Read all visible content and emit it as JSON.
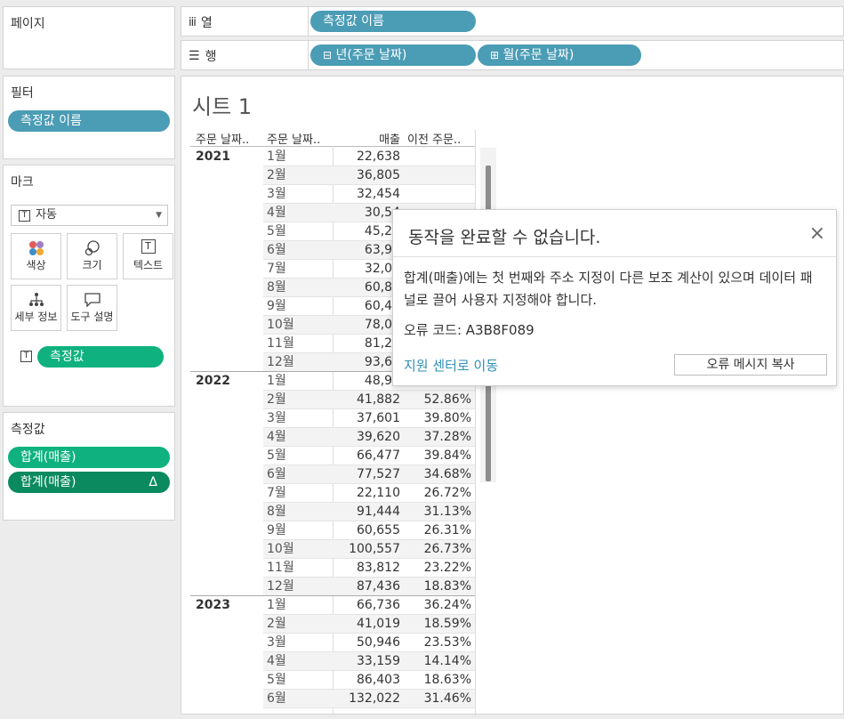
{
  "pages": {
    "title": "페이지"
  },
  "columns_shelf": {
    "label": "열",
    "pill": "측정값 이름"
  },
  "rows_shelf": {
    "label": "행",
    "pills": [
      "년(주문 날짜)",
      "월(주문 날짜)"
    ]
  },
  "filters": {
    "title": "필터",
    "pill": "측정값 이름"
  },
  "marks": {
    "title": "마크",
    "type": "자동",
    "buttons": [
      {
        "label": "색상",
        "icon": "color-icon"
      },
      {
        "label": "크기",
        "icon": "size-icon"
      },
      {
        "label": "텍스트",
        "icon": "text-icon"
      },
      {
        "label": "세부 정보",
        "icon": "detail-icon"
      },
      {
        "label": "도구 설명",
        "icon": "tooltip-icon"
      }
    ],
    "field_pill": "측정값"
  },
  "measure_values": {
    "title": "측정값",
    "pills": [
      "합계(매출)",
      "합계(매출)"
    ],
    "delta": "Δ"
  },
  "sheet": {
    "title": "시트 1",
    "headers": [
      "주문 날짜..",
      "주문 날짜..",
      "매출",
      "이전 주문.."
    ],
    "years": [
      {
        "year": "2021",
        "rows": [
          {
            "m": "1월",
            "s": "22,638",
            "p": ""
          },
          {
            "m": "2월",
            "s": "36,805",
            "p": ""
          },
          {
            "m": "3월",
            "s": "32,454",
            "p": ""
          },
          {
            "m": "4월",
            "s": "30,54",
            "p": ""
          },
          {
            "m": "5월",
            "s": "45,29",
            "p": ""
          },
          {
            "m": "6월",
            "s": "63,99",
            "p": ""
          },
          {
            "m": "7월",
            "s": "32,00",
            "p": ""
          },
          {
            "m": "8월",
            "s": "60,85",
            "p": ""
          },
          {
            "m": "9월",
            "s": "60,41",
            "p": ""
          },
          {
            "m": "10월",
            "s": "78,06",
            "p": ""
          },
          {
            "m": "11월",
            "s": "81,22",
            "p": ""
          },
          {
            "m": "12월",
            "s": "93,67",
            "p": ""
          }
        ]
      },
      {
        "year": "2022",
        "rows": [
          {
            "m": "1월",
            "s": "48,98",
            "p": ""
          },
          {
            "m": "2월",
            "s": "41,882",
            "p": "52.86%"
          },
          {
            "m": "3월",
            "s": "37,601",
            "p": "39.80%"
          },
          {
            "m": "4월",
            "s": "39,620",
            "p": "37.28%"
          },
          {
            "m": "5월",
            "s": "66,477",
            "p": "39.84%"
          },
          {
            "m": "6월",
            "s": "77,527",
            "p": "34.68%"
          },
          {
            "m": "7월",
            "s": "22,110",
            "p": "26.72%"
          },
          {
            "m": "8월",
            "s": "91,444",
            "p": "31.13%"
          },
          {
            "m": "9월",
            "s": "60,655",
            "p": "26.31%"
          },
          {
            "m": "10월",
            "s": "100,557",
            "p": "26.73%"
          },
          {
            "m": "11월",
            "s": "83,812",
            "p": "23.22%"
          },
          {
            "m": "12월",
            "s": "87,436",
            "p": "18.83%"
          }
        ]
      },
      {
        "year": "2023",
        "rows": [
          {
            "m": "1월",
            "s": "66,736",
            "p": "36.24%"
          },
          {
            "m": "2월",
            "s": "41,019",
            "p": "18.59%"
          },
          {
            "m": "3월",
            "s": "50,946",
            "p": "23.53%"
          },
          {
            "m": "4월",
            "s": "33,159",
            "p": "14.14%"
          },
          {
            "m": "5월",
            "s": "86,403",
            "p": "18.63%"
          },
          {
            "m": "6월",
            "s": "132,022",
            "p": "31.46%"
          }
        ]
      }
    ]
  },
  "dialog": {
    "title": "동작을 완료할 수 없습니다.",
    "close": "×",
    "message": "합계(매출)에는 첫 번째와 주소 지정이 다른 보조 계산이 있으며 데이터 패널로 끌어 사용자 지정해야 합니다.",
    "error_code": "오류 코드: A3B8F089",
    "support_link": "지원 센터로 이동",
    "copy_button": "오류 메시지 복사"
  },
  "colors": {
    "dimension_pill": "#4b9cb5",
    "measure_pill": "#0fb27e",
    "measure_pill_dark": "#0b8a60",
    "link": "#2f8fb5",
    "band": "#f3f3f3"
  }
}
